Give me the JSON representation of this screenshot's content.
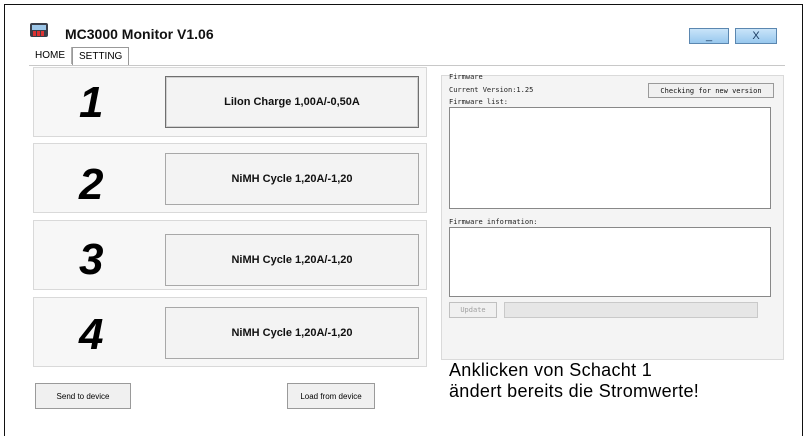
{
  "window": {
    "title": "MC3000 Monitor V1.06",
    "minimize_label": "_",
    "close_label": "X",
    "app_icon": "battery-charger-icon"
  },
  "tabs": [
    {
      "label": "HOME",
      "active": false
    },
    {
      "label": "SETTING",
      "active": true
    }
  ],
  "slots": [
    {
      "number": "1",
      "program": "LiIon Charge 1,00A/-0,50A",
      "selected": true
    },
    {
      "number": "2",
      "program": "NiMH Cycle 1,20A/-1,20",
      "selected": false
    },
    {
      "number": "3",
      "program": "NiMH Cycle 1,20A/-1,20",
      "selected": false
    },
    {
      "number": "4",
      "program": "NiMH Cycle 1,20A/-1,20",
      "selected": false
    }
  ],
  "actions": {
    "send_label": "Send to device",
    "load_label": "Load from device"
  },
  "firmware": {
    "group_label": "Firmware",
    "current_version_label": "Current Version:1.25",
    "check_button_label": "Checking for new version",
    "list_label": "Firmware list:",
    "info_label": "Firmware information:",
    "update_button_label": "Update"
  },
  "annotation": {
    "line1": "Anklicken von Schacht 1",
    "line2": "ändert bereits die Stromwerte!"
  }
}
